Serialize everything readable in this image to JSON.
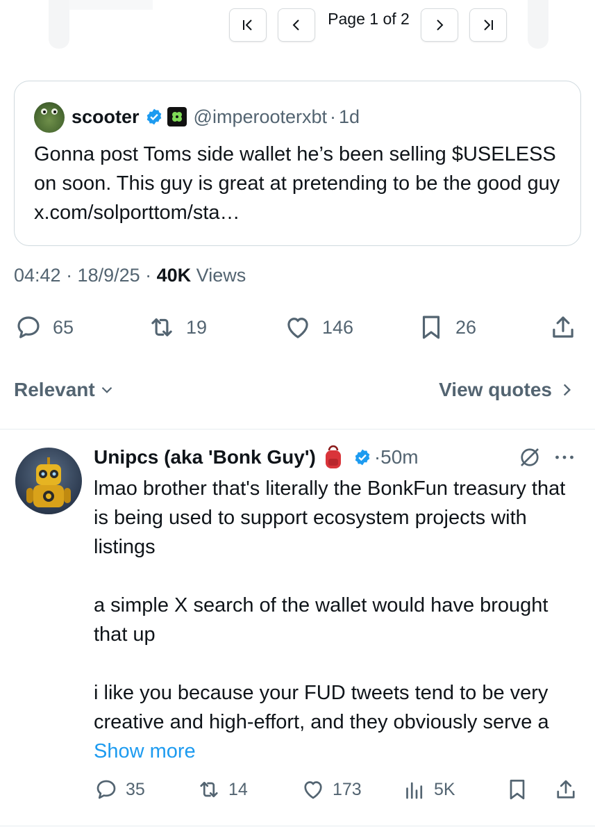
{
  "pager": {
    "first_label": "⟨",
    "prev_label": "‹",
    "page_label": "Page 1 of 2",
    "next_label": "›",
    "last_label": "⟩"
  },
  "quoted_post": {
    "display_name": "scooter",
    "handle": "@imperooterxbt",
    "separator": "·",
    "time": "1d",
    "text": "Gonna post Toms side wallet he’s been selling $USELESS on soon. This guy is great at pretending to be the good guy x.com/solporttom/sta…"
  },
  "post_meta": {
    "time": "04:42 · 18/9/25 · ",
    "views_count": "40K",
    "views_label": " Views"
  },
  "actions": {
    "replies": "65",
    "reposts": "19",
    "likes": "146",
    "bookmarks": "26"
  },
  "filters": {
    "sort_label": "Relevant",
    "view_quotes_label": "View quotes"
  },
  "reply": {
    "display_name": "Unipcs (aka 'Bonk Guy')",
    "time": "·50m",
    "paragraphs": [
      "lmao brother that's literally the BonkFun treasury that is being used to support ecosystem projects with listings",
      "a simple X search of the wallet would have brought that up",
      "i like you because your FUD tweets tend to be very creative and high-effort, and they obviously serve a "
    ],
    "show_more": "Show more",
    "actions": {
      "replies": "35",
      "reposts": "14",
      "likes": "173",
      "views": "5K"
    }
  },
  "colors": {
    "accent_blue": "#1d9bf0",
    "muted": "#536471",
    "text": "#0f1419",
    "border": "#cfd9de"
  }
}
